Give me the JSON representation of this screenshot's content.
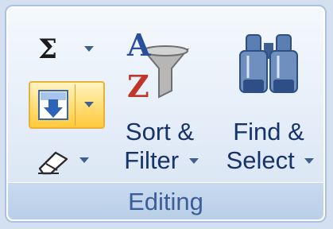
{
  "group_label": "Editing",
  "sort_filter": {
    "line1": "Sort &",
    "line2": "Filter"
  },
  "find_select": {
    "line1": "Find &",
    "line2": "Select"
  },
  "icons": {
    "autosum": "sigma-icon",
    "fill": "fill-down-icon",
    "clear": "eraser-icon",
    "sort_filter": "sort-az-funnel-icon",
    "find_select": "binoculars-icon"
  },
  "colors": {
    "ribbon_bg": "#e4edf8",
    "footer_bg": "#c1d5ec",
    "label_text": "#17336a",
    "footer_text": "#3b5e96",
    "highlight": "#ffd966"
  }
}
